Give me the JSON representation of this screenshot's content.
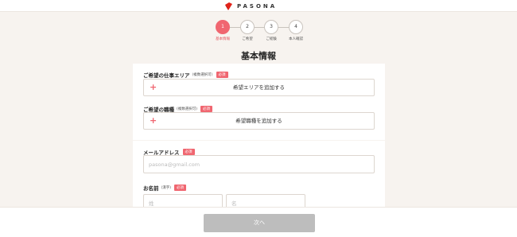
{
  "header": {
    "logo_text": "PASONA",
    "brand_color": "#e2231a"
  },
  "steps": [
    {
      "number": "1",
      "label": "基本情報",
      "active": true
    },
    {
      "number": "2",
      "label": "ご希望",
      "active": false
    },
    {
      "number": "3",
      "label": "ご経験",
      "active": false
    },
    {
      "number": "4",
      "label": "本人確認",
      "active": false
    }
  ],
  "page_title": "基本情報",
  "form": {
    "area": {
      "label": "ご希望の仕事エリア",
      "sub": "(複数選択可)",
      "badge": "必須",
      "button_icon": "plus-icon",
      "button_label": "希望エリアを追加する"
    },
    "job": {
      "label": "ご希望の職種",
      "sub": "(複数選択可)",
      "badge": "必須",
      "button_icon": "plus-icon",
      "button_label": "希望職種を追加する"
    },
    "email": {
      "label": "メールアドレス",
      "badge": "必須",
      "placeholder": "pasona@gmail.com",
      "value": ""
    },
    "name": {
      "label": "お名前",
      "sub": "(漢字)",
      "badge": "必須",
      "last_placeholder": "姓",
      "first_placeholder": "名"
    }
  },
  "footer": {
    "next_label": "次へ"
  },
  "colors": {
    "accent": "#f06670",
    "background": "#f7f3ef",
    "disabled_button": "#bdbdbd"
  }
}
